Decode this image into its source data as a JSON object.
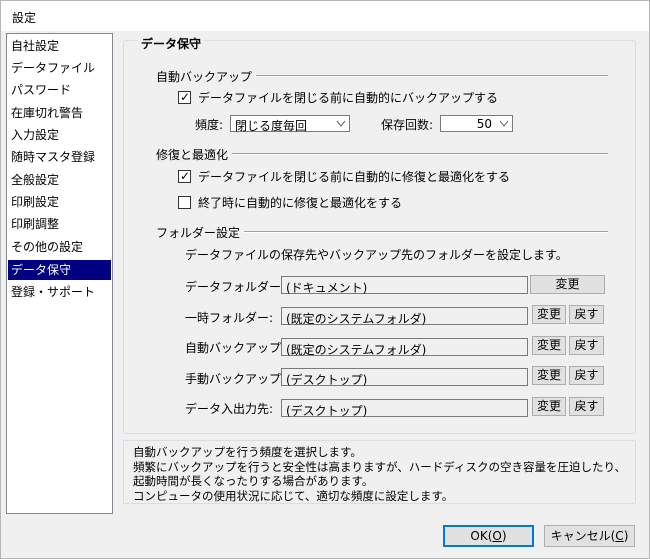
{
  "window": {
    "title": "設定"
  },
  "sidebar": {
    "items": [
      "自社設定",
      "データファイル",
      "パスワード",
      "在庫切れ警告",
      "入力設定",
      "随時マスタ登録",
      "全般設定",
      "印刷設定",
      "印刷調整",
      "その他の設定",
      "データ保守",
      "登録・サポート"
    ],
    "selected": "データ保守"
  },
  "panel": {
    "title": "データ保守",
    "autobackup": {
      "section": "自動バックアップ",
      "checkbox_label": "データファイルを閉じる前に自動的にバックアップする",
      "checked": true,
      "frequency_label": "頻度:",
      "frequency_value": "閉じる度毎回",
      "count_label": "保存回数:",
      "count_value": "50"
    },
    "repair": {
      "section": "修復と最適化",
      "option1": "データファイルを閉じる前に自動的に修復と最適化をする",
      "option1_checked": true,
      "option2": "終了時に自動的に修復と最適化をする",
      "option2_checked": false
    },
    "folders": {
      "section": "フォルダー設定",
      "description": "データファイルの保存先やバックアップ先のフォルダーを設定します。",
      "rows": [
        {
          "label": "データフォルダー:",
          "path": "(ドキュメント)",
          "change": "変更"
        },
        {
          "label": "一時フォルダー:",
          "path": "(既定のシステムフォルダ)",
          "change": "変更",
          "reset": "戻す"
        },
        {
          "label": "自動バックアップ:",
          "path": "(既定のシステムフォルダ)",
          "change": "変更",
          "reset": "戻す"
        },
        {
          "label": "手動バックアップ:",
          "path": "(デスクトップ)",
          "change": "変更",
          "reset": "戻す"
        },
        {
          "label": "データ入出力先:",
          "path": "(デスクトップ)",
          "change": "変更",
          "reset": "戻す"
        }
      ]
    }
  },
  "help": {
    "lines": [
      "自動バックアップを行う頻度を選択します。",
      "頻繁にバックアップを行うと安全性は高まりますが、ハードディスクの空き容量を圧迫したり、",
      "起動時間が長くなったりする場合があります。",
      "コンピュータの使用状況に応じて、適切な頻度に設定します。"
    ]
  },
  "footer": {
    "ok_label": "OK(",
    "ok_key": "O",
    "ok_close": ")",
    "cancel_label": "キャンセル(",
    "cancel_key": "C",
    "cancel_close": ")"
  },
  "colors": {
    "selection": "#000080",
    "default_button_border": "#0078d7",
    "dialog_background": "#f0f0f0"
  }
}
